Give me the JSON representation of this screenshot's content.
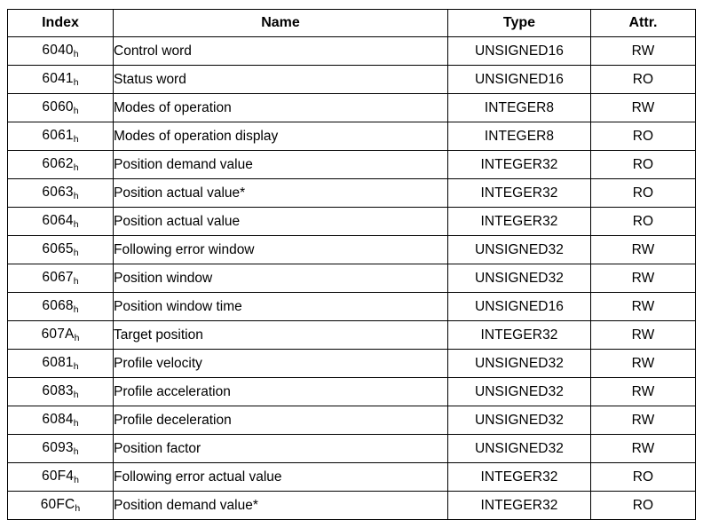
{
  "table": {
    "columns": [
      {
        "key": "index",
        "label": "Index",
        "align": "center"
      },
      {
        "key": "name",
        "label": "Name",
        "align": "left"
      },
      {
        "key": "type",
        "label": "Type",
        "align": "center"
      },
      {
        "key": "attr",
        "label": "Attr.",
        "align": "center"
      }
    ],
    "hex_subscript": "h",
    "rows": [
      {
        "index": "6040",
        "name": "Control word",
        "type": "UNSIGNED16",
        "attr": "RW"
      },
      {
        "index": "6041",
        "name": "Status word",
        "type": "UNSIGNED16",
        "attr": "RO"
      },
      {
        "index": "6060",
        "name": "Modes of operation",
        "type": "INTEGER8",
        "attr": "RW"
      },
      {
        "index": "6061",
        "name": "Modes of operation display",
        "type": "INTEGER8",
        "attr": "RO"
      },
      {
        "index": "6062",
        "name": "Position demand value",
        "type": "INTEGER32",
        "attr": "RO"
      },
      {
        "index": "6063",
        "name": "Position actual value*",
        "type": "INTEGER32",
        "attr": "RO"
      },
      {
        "index": "6064",
        "name": "Position actual value",
        "type": "INTEGER32",
        "attr": "RO"
      },
      {
        "index": "6065",
        "name": "Following error window",
        "type": "UNSIGNED32",
        "attr": "RW"
      },
      {
        "index": "6067",
        "name": "Position window",
        "type": "UNSIGNED32",
        "attr": "RW"
      },
      {
        "index": "6068",
        "name": "Position window time",
        "type": "UNSIGNED16",
        "attr": "RW"
      },
      {
        "index": "607A",
        "name": "Target position",
        "type": "INTEGER32",
        "attr": "RW"
      },
      {
        "index": "6081",
        "name": "Profile velocity",
        "type": "UNSIGNED32",
        "attr": "RW"
      },
      {
        "index": "6083",
        "name": "Profile acceleration",
        "type": "UNSIGNED32",
        "attr": "RW"
      },
      {
        "index": "6084",
        "name": "Profile deceleration",
        "type": "UNSIGNED32",
        "attr": "RW"
      },
      {
        "index": "6093",
        "name": "Position factor",
        "type": "UNSIGNED32",
        "attr": "RW"
      },
      {
        "index": "60F4",
        "name": "Following error actual value",
        "type": "INTEGER32",
        "attr": "RO"
      },
      {
        "index": "60FC",
        "name": "Position demand value*",
        "type": "INTEGER32",
        "attr": "RO"
      }
    ]
  },
  "colors": {
    "border": "#000000",
    "text": "#000000",
    "background": "#ffffff"
  }
}
